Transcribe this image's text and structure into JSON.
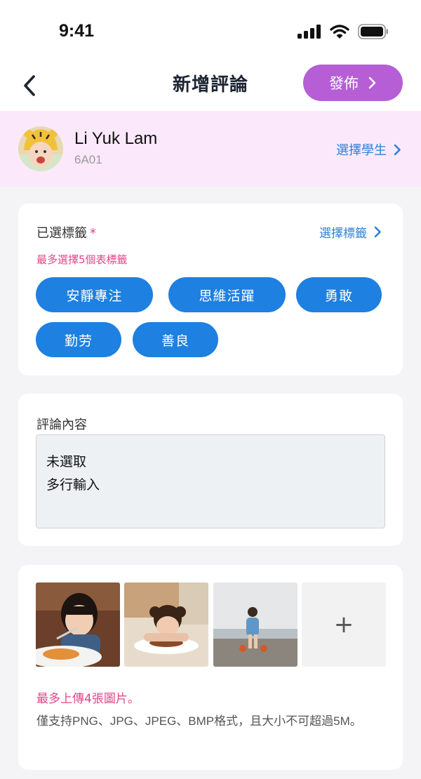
{
  "status_bar": {
    "time": "9:41"
  },
  "header": {
    "title": "新增評論",
    "publish_label": "發佈"
  },
  "student": {
    "name": "Li Yuk Lam",
    "class": "6A01",
    "select_label": "選擇學生"
  },
  "tags_card": {
    "label": "已選標籤",
    "required_mark": "*",
    "select_label": "選擇標籤",
    "hint": "最多選擇5個表標籤",
    "tags": [
      "安靜專注",
      "思維活躍",
      "勇敢",
      "勤劳",
      "善良"
    ]
  },
  "comment_card": {
    "label": "評論內容",
    "value_line1": "未選取",
    "value_line2": "多行輸入"
  },
  "photos_card": {
    "limit_text": "最多上傳4張圖片。",
    "format_text": "僅支持PNG、JPG、JPEG、BMP格式，且大小不可超過5M。",
    "add_label": "+"
  },
  "colors": {
    "accent_publish": "#b55ed6",
    "tag_blue": "#1e80e0",
    "link_blue": "#2f80d6",
    "hint_pink": "#e0458a",
    "student_bar_bg": "#fbe9fb"
  },
  "icons": [
    "signal-icon",
    "wifi-icon",
    "battery-icon",
    "back-arrow-icon",
    "chevron-right-icon"
  ]
}
